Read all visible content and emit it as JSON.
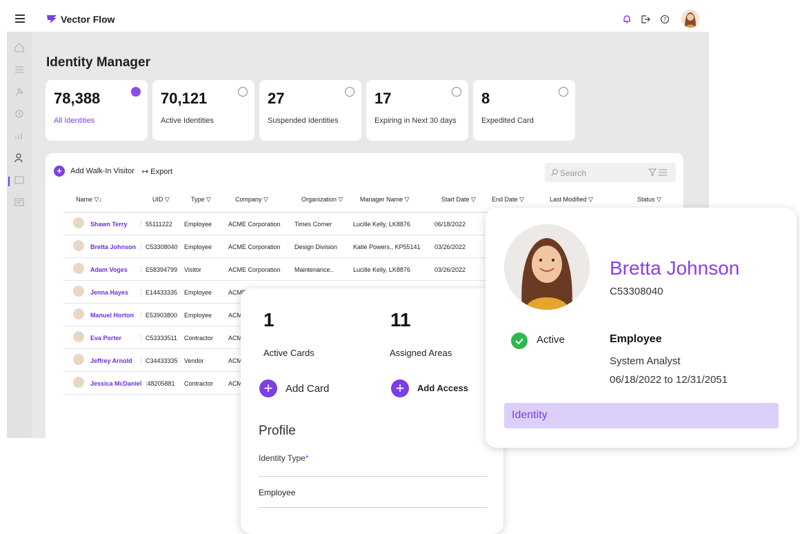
{
  "app": {
    "brand": "Vector Flow"
  },
  "page": {
    "title": "Identity Manager"
  },
  "kpis": [
    {
      "value": "78,388",
      "label": "All Identities",
      "selected": true
    },
    {
      "value": "70,121",
      "label": "Active Identities",
      "selected": false
    },
    {
      "value": "27",
      "label": "Suspended Identities",
      "selected": false
    },
    {
      "value": "17",
      "label": "Expiring in Next 30 days",
      "selected": false
    },
    {
      "value": "8",
      "label": "Expedited Card",
      "selected": false
    }
  ],
  "toolbar": {
    "add_label": "Add Walk-In Visitor",
    "export_label": "Export"
  },
  "search": {
    "placeholder": "Search"
  },
  "table": {
    "columns": [
      "Name",
      "UID",
      "Type",
      "Company",
      "Organization",
      "Manager Name",
      "Start Date",
      "End Date",
      "Last Modified",
      "Status"
    ],
    "rows": [
      {
        "name": "Shawn Terry",
        "uid": "55111222",
        "type": "Employee",
        "company": "ACME Corporation",
        "org": "Times Corner",
        "manager": "Lucille Kelly, LK8876",
        "start": "06/18/2022"
      },
      {
        "name": "Bretta Johnson",
        "uid": "C53308040",
        "type": "Employee",
        "company": "ACME Corporation",
        "org": "Design Division",
        "manager": "Katie Powers., KP55141",
        "start": "03/26/2022"
      },
      {
        "name": "Adam Voges",
        "uid": "E58394799",
        "type": "Visitor",
        "company": "ACME Corporation",
        "org": "Maintenance..",
        "manager": "Lucille Kelly, LK8876",
        "start": "03/26/2022"
      },
      {
        "name": "Jenna Hayes",
        "uid": "E14433335",
        "type": "Employee",
        "company": "ACME C",
        "org": "",
        "manager": "",
        "start": ""
      },
      {
        "name": "Manuel Horton",
        "uid": "E53903800",
        "type": "Employee",
        "company": "ACM",
        "org": "",
        "manager": "",
        "start": ""
      },
      {
        "name": "Eva Porter",
        "uid": "C53333511",
        "type": "Contractor",
        "company": "ACM",
        "org": "",
        "manager": "",
        "start": ""
      },
      {
        "name": "Jeffrey Arnold",
        "uid": "C34433335",
        "type": "Vendor",
        "company": "ACM",
        "org": "",
        "manager": "",
        "start": ""
      },
      {
        "name": "Jessica McDaniel",
        "uid": ":48205881",
        "type": "Contractor",
        "company": "ACM",
        "org": "",
        "manager": "",
        "start": ""
      }
    ]
  },
  "summary_card": {
    "active_cards": "1",
    "active_cards_label": "Active Cards",
    "assigned_areas": "11",
    "assigned_areas_label": "Assigned Areas",
    "add_card_label": "Add Card",
    "add_access_label": "Add Access",
    "profile_heading": "Profile",
    "identity_type_label": "Identity Type",
    "identity_type_required": "*",
    "identity_type_value": "Employee"
  },
  "profile_card": {
    "name": "Bretta Johnson",
    "uid": "C53308040",
    "status": "Active",
    "type": "Employee",
    "title": "System Analyst",
    "dates": "06/18/2022 to 12/31/2051",
    "section": "Identity"
  },
  "colors": {
    "accent": "#7b3fe4",
    "success": "#2fb84f",
    "app_bg": "#e8e8e8"
  }
}
